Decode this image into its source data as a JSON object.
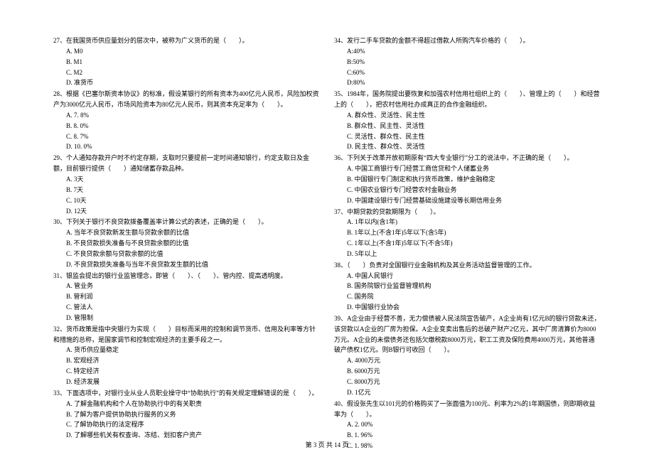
{
  "left": {
    "q27": {
      "text": "27、在我国货币供应量划分的层次中，被称为广义货币的是（　　）。",
      "a": "A. M0",
      "b": "B. M1",
      "c": "C. M2",
      "d": "D. 准货币"
    },
    "q28": {
      "text": "28、根据《巴塞尔斯资本协议》的标准，假设某银行的所有资本为400亿元人民币，风险加权资产为3000亿元人民币，市场风险资本为80亿元人民币，则其资本充足率为（　　）。",
      "a": "A. 7. 8%",
      "b": "B. 8. 0%",
      "c": "C. 8. 7%",
      "d": "D. 10. 0%"
    },
    "q29": {
      "text": "29、个人通知存款开户时不约定存期，支取时只要提前一定时间通知银行，约定支取日及金额，目前银行提供（　　）通知储蓄存款品种。",
      "a": "A. 3天",
      "b": "B. 7天",
      "c": "C. 10天",
      "d": "D. 12天"
    },
    "q30": {
      "text": "30、下列关于银行不良贷款拨备覆盖率计算公式的表述，正确的是（　　）。",
      "a": "A. 当年不良贷款新发生额与贷款余额的比值",
      "b": "B. 不良贷款损失准备与不良贷款余额的比值",
      "c": "C. 不良贷款余额与贷款余额的比值",
      "d": "D. 不良贷款损失准备与当年不良贷款发生额的比值"
    },
    "q31": {
      "text": "31、银监会提出的银行业监管理念，即管（　　）、（　　）、管内控、提高透明度。",
      "a": "A. 管业务",
      "b": "B. 管利润",
      "c": "C. 管法人",
      "d": "D. 管限制"
    },
    "q32": {
      "text": "32、货币政策是指中央银行为实现（　　）目标而采用的控制和调节货币、信用及利率等方针和措施的总称，是国家调节和控制宏观经济的主要手段之一。",
      "a": "A. 货币供应量稳定",
      "b": "B. 宏观经济",
      "c": "C. 特定经济",
      "d": "D. 经济发展"
    },
    "q33": {
      "text": "33、下面选项中，对银行业从业人员职业操守中“协助执行”的有关规定理解错误的是（　　）。",
      "a": "A. 了解金融机构和个人在协助执行中的有关职责",
      "b": "B. 了解为客户提供协助执行服务的义务",
      "c": "C. 了解协助执行的法定程序",
      "d": "D. 了解哪些机关有权查询、冻结、划扣客户资产"
    }
  },
  "right": {
    "q34": {
      "text": "34、发行二手车贷款的金额不得超过借款人所购汽车价格的（　　）。",
      "a": "A:40%",
      "b": "B:50%",
      "c": "C:60%",
      "d": "D:80%"
    },
    "q35": {
      "text": "35、1984年，国务院提出要恢复和加强农村信用社组织上的（　　）、管理上的（　　）和经营上的（　　），把农村信用社办成真正的合作金融组织。",
      "a": "A. 群众性、灵活性、民主性",
      "b": "B. 群众性、民主性、灵活性",
      "c": "C. 灵活性、群众性、民主性",
      "d": "D. 民主性、群众性、灵活性"
    },
    "q36": {
      "text": "36、下列关于改革开放初期原有“四大专业银行”分工的说法中，不正确的是（　　）。",
      "a": "A. 中国工商银行专门经营工商信贷和个人储蓄业务",
      "b": "B. 中国银行专门制定和执行货币政策，维护金融稳定",
      "c": "C. 中国农业银行专门经营农村金融业务",
      "d": "D. 中国建设银行专门经营基础设施建设等长期信用业务"
    },
    "q37": {
      "text": "37、中期贷款的贷款期限为（　　）。",
      "a": "A. 1年以内(含1年)",
      "b": "B. 1年以上(不含1年)5年以下(含5年)",
      "c": "C. 1年以上(不含1年)5年以下(不含5年)",
      "d": "D. 5年以上"
    },
    "q38": {
      "text": "38、（　　）负责对全国银行业金融机构及其业务活动监督管理的工作。",
      "a": "A. 中国人民银行",
      "b": "B. 国务院银行业监督管理机构",
      "c": "C. 国务院",
      "d": "D. 中国银行业协会"
    },
    "q39": {
      "text": "39、A企业由于经营不善，无力偿债被人民法院宣告破产，A企业尚有1亿元B的银行贷款未还，该贷款以A企业的厂房为担保。A企业变卖出售后的总破产财产2亿元，其中厂房清算价为8000万元。A企业的未偿债务还包括欠缴税款8000万元，职工工资及保险费用4000万元，其他普通破产债权1亿元。则B银行可收回（　　）。",
      "a": "A. 4000万元",
      "b": "B. 6000万元",
      "c": "C. 8000万元",
      "d": "D. 1亿元"
    },
    "q40": {
      "text": "40、假设张先生以101元的价格购买了一张面值为100元、利率为2%的1年期国债，则即期收益率为（　　）。",
      "a": "A. 2. 00%",
      "b": "B. 1. 96%",
      "c": "C. 1. 98%"
    }
  },
  "footer": "第 3 页 共 14 页"
}
